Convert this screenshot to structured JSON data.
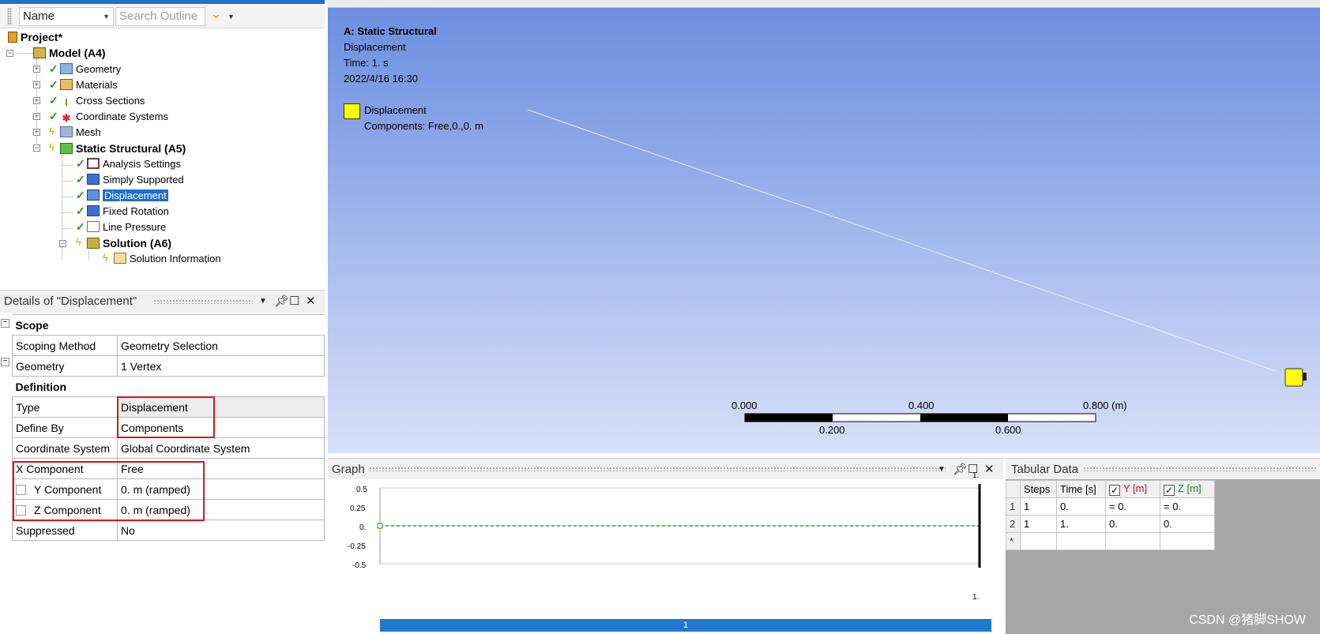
{
  "outline": {
    "name_combo": "Name",
    "search_placeholder": "Search Outline",
    "tree": {
      "project": "Project*",
      "model": "Model (A4)",
      "geometry": "Geometry",
      "materials": "Materials",
      "cross_sections": "Cross Sections",
      "coordinate_systems": "Coordinate Systems",
      "mesh": "Mesh",
      "static_structural": "Static Structural (A5)",
      "analysis_settings": "Analysis Settings",
      "simply_supported": "Simply Supported",
      "displacement": "Displacement",
      "fixed_rotation": "Fixed Rotation",
      "line_pressure": "Line Pressure",
      "solution": "Solution (A6)",
      "solution_information": "Solution Information"
    }
  },
  "details": {
    "title": "Details of \"Displacement\"",
    "groups": {
      "scope": "Scope",
      "definition": "Definition"
    },
    "rows": [
      {
        "key": "Scoping Method",
        "value": "Geometry Selection"
      },
      {
        "key": "Geometry",
        "value": "1 Vertex"
      },
      {
        "key": "Type",
        "value": "Displacement"
      },
      {
        "key": "Define By",
        "value": "Components"
      },
      {
        "key": "Coordinate System",
        "value": "Global Coordinate System"
      },
      {
        "key": "X Component",
        "value": "Free"
      },
      {
        "key": "Y Component",
        "value": "0. m  (ramped)"
      },
      {
        "key": "Z Component",
        "value": "0. m  (ramped)"
      },
      {
        "key": "Suppressed",
        "value": "No"
      }
    ]
  },
  "viewport": {
    "title": "A: Static Structural",
    "line1": "Displacement",
    "line2": "Time: 1. s",
    "line3": "2022/4/16 16:30",
    "legend_label": "Displacement",
    "legend_components": "Components: Free,0.,0. m",
    "scale": {
      "top_labels": [
        "0.000",
        "0.400",
        "0.800 (m)"
      ],
      "bottom_labels": [
        "0.200",
        "0.600"
      ]
    }
  },
  "graph": {
    "title": "Graph",
    "y_ticks": [
      "0.5",
      "0.25",
      "0.",
      "-0.25",
      "-0.5"
    ],
    "top_right": "1.",
    "bottom_right": "1.",
    "progress_label": "1"
  },
  "tabular": {
    "title": "Tabular Data",
    "headers": [
      "Steps",
      "Time [s]",
      "Y [m]",
      "Z [m]"
    ],
    "rows": [
      {
        "n": "1",
        "steps": "1",
        "time": "0.",
        "y": "= 0.",
        "z": "= 0."
      },
      {
        "n": "2",
        "steps": "1",
        "time": "1.",
        "y": "0.",
        "z": "0."
      }
    ],
    "new_row_marker": "*"
  },
  "watermark": "CSDN @猪脚SHOW",
  "colors": {
    "selection": "#1f6fd1",
    "highlight_box": "#e0101a",
    "legend_yellow": "#ffff00",
    "y_header": "#d01010",
    "z_header": "#109010"
  }
}
